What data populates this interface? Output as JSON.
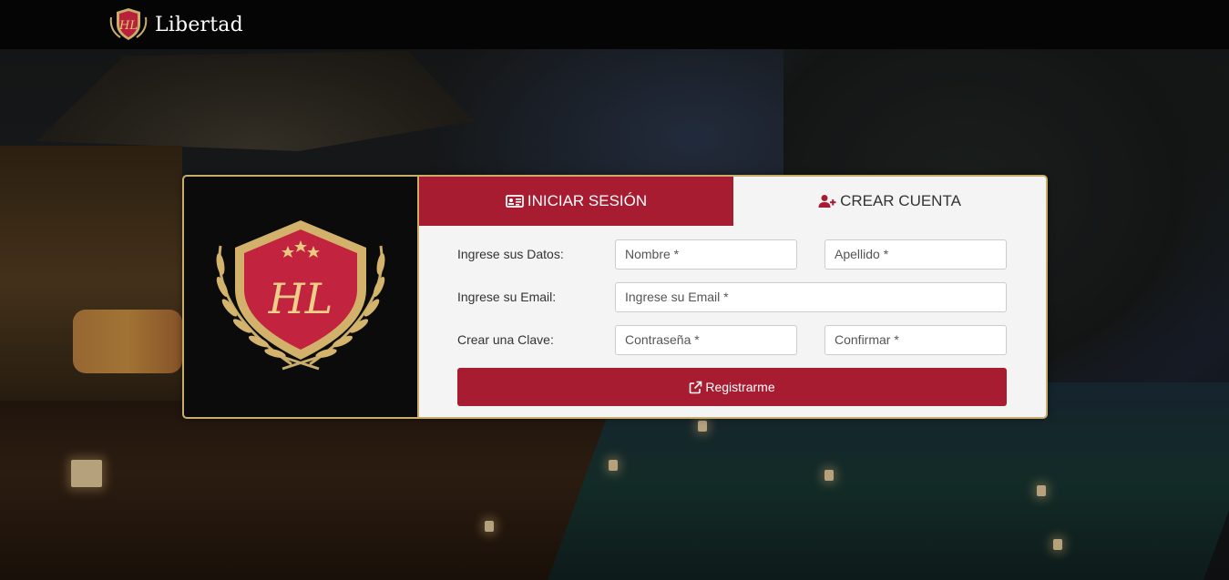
{
  "brand": {
    "name": "Libertad",
    "logo": "shield-logo-icon"
  },
  "colors": {
    "accent": "#a81c32",
    "gold": "#c9ad6b",
    "navbar": "#050505"
  },
  "tabs": [
    {
      "label": "INICIAR SESIÓN",
      "icon": "id-card-icon",
      "active": true
    },
    {
      "label": "CREAR CUENTA",
      "icon": "user-plus-icon",
      "active": false
    }
  ],
  "form": {
    "labels": {
      "datos": "Ingrese sus Datos:",
      "email": "Ingrese su Email:",
      "clave": "Crear una Clave:"
    },
    "placeholders": {
      "nombre": "Nombre *",
      "apellido": "Apellido *",
      "email": "Ingrese su Email *",
      "password": "Contraseña *",
      "confirm": "Confirmar *"
    },
    "submit_label": "Registrarme",
    "submit_icon": "external-link-icon"
  }
}
